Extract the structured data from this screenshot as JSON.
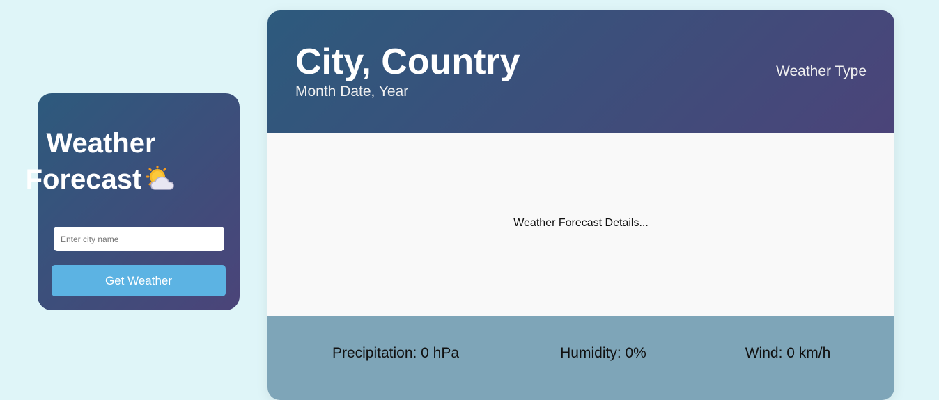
{
  "search": {
    "title_line1": "Weather",
    "title_line2": "Forecast",
    "title_icon": "sun-behind-cloud-icon",
    "input_placeholder": "Enter city name",
    "input_value": "",
    "button_label": "Get Weather"
  },
  "header": {
    "location": "City, Country",
    "date": "Month Date, Year",
    "weather_type": "Weather Type"
  },
  "body": {
    "details": "Weather Forecast Details..."
  },
  "footer": {
    "precipitation": "Precipitation: 0 hPa",
    "humidity": "Humidity: 0%",
    "wind": "Wind: 0 km/h"
  },
  "colors": {
    "page_background": "#dff5f8",
    "gradient_start": "#2d5a7d",
    "gradient_end": "#4b4479",
    "button": "#5cb3e3",
    "footer": "#7ea5b8",
    "body": "#f9f9f9"
  }
}
